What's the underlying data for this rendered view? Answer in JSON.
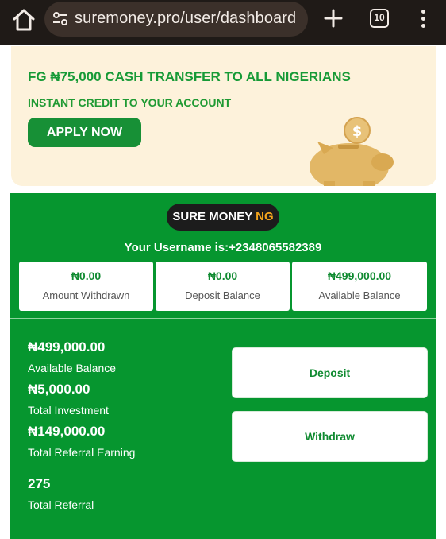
{
  "browser": {
    "url": "suremoney.pro/user/dashboard",
    "tab_count": "10",
    "icons": [
      "home-icon",
      "site-settings-icon",
      "plus-icon",
      "tabs-icon",
      "more-vert-icon"
    ]
  },
  "banner": {
    "title": "FG ₦75,000 CASH TRANSFER TO ALL NIGERIANS",
    "subtitle": "INSTANT CREDIT TO YOUR ACCOUNT",
    "apply_label": "APPLY NOW",
    "image": "piggy-bank-coin-icon"
  },
  "dashboard": {
    "logo_main": "SURE MONEY ",
    "logo_accent": "NG",
    "username": "Your Username is:+2348065582389",
    "cards": [
      {
        "value": "₦0.00",
        "label": "Amount Withdrawn"
      },
      {
        "value": "₦0.00",
        "label": "Deposit Balance"
      },
      {
        "value": "₦499,000.00",
        "label": "Available Balance"
      }
    ],
    "stats": [
      {
        "value": "₦499,000.00",
        "label": "Available Balance"
      },
      {
        "value": "₦5,000.00",
        "label": "Total Investment"
      },
      {
        "value": "₦149,000.00",
        "label": "Total Referral Earning"
      },
      {
        "value": "275",
        "label": "Total Referral"
      }
    ],
    "deposit_label": "Deposit",
    "withdraw_label": "Withdraw"
  },
  "colors": {
    "brand_green": "#06962f",
    "banner_bg": "#fdf2db",
    "accent_orange": "#f4a51d",
    "browser_bar": "#1f1a17"
  }
}
